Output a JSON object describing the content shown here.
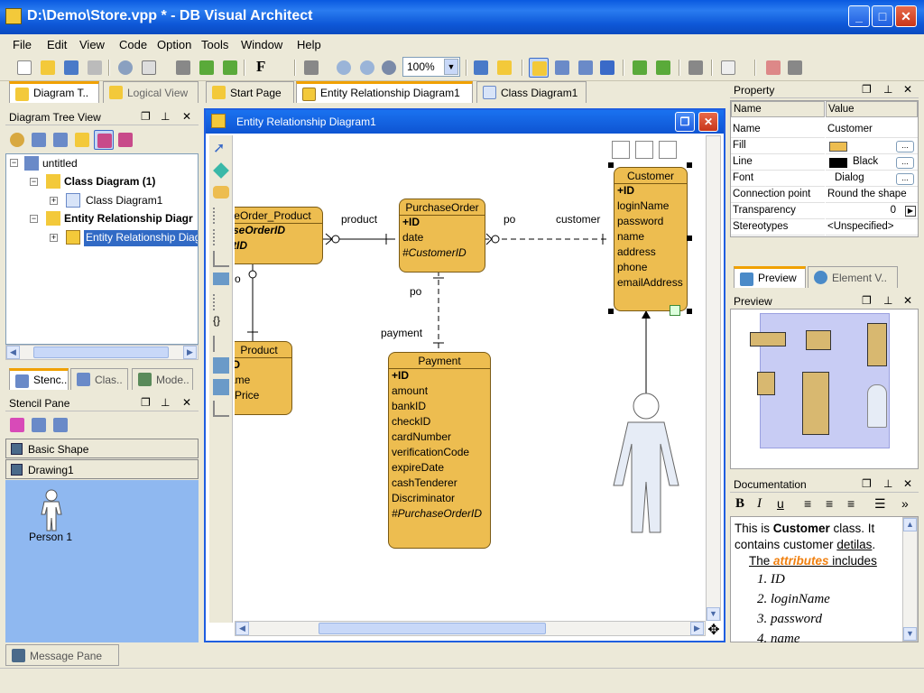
{
  "window": {
    "title": "D:\\Demo\\Store.vpp * - DB Visual Architect"
  },
  "menu": [
    "File",
    "Edit",
    "View",
    "Code",
    "Option",
    "Tools",
    "Window",
    "Help"
  ],
  "toolbar": {
    "zoom": "100%"
  },
  "left_tabs": {
    "diagram_tree": "Diagram T..",
    "logical_view": "Logical View"
  },
  "tree_panel": {
    "title": "Diagram Tree View",
    "nodes": {
      "root": "untitled",
      "class_diagram": "Class Diagram (1)",
      "class_diagram1": "Class Diagram1",
      "erd": "Entity Relationship Diagr",
      "erd1": "Entity Relationship Diag"
    }
  },
  "lower_tabs": {
    "stencil": "Stenc..",
    "class": "Clas..",
    "model": "Mode.."
  },
  "stencil": {
    "title": "Stencil Pane",
    "categories": [
      "Basic Shape",
      "Drawing1"
    ],
    "item": "Person 1"
  },
  "doc_tabs": {
    "start": "Start Page",
    "erd": "Entity Relationship Diagram1",
    "class": "Class Diagram1"
  },
  "diagram": {
    "title": "Entity Relationship Diagram1",
    "entities": {
      "pop": {
        "name": "seOrder_Product",
        "rows": [
          "haseOrderID",
          "uctID"
        ]
      },
      "product": {
        "name": "Product",
        "rows": [
          "ID",
          "ame",
          "itPrice"
        ]
      },
      "purchase_order": {
        "name": "PurchaseOrder",
        "rows": [
          "+ID",
          "date",
          "#CustomerID"
        ]
      },
      "payment": {
        "name": "Payment",
        "rows": [
          "+ID",
          "amount",
          "bankID",
          "checkID",
          "cardNumber",
          "verificationCode",
          "expireDate",
          "cashTenderer",
          "Discriminator",
          "#PurchaseOrderID"
        ]
      },
      "customer": {
        "name": "Customer",
        "rows": [
          "+ID",
          "loginName",
          "password",
          "name",
          "address",
          "phone",
          "emailAddress"
        ]
      }
    },
    "labels": {
      "product": "product",
      "po1": "po",
      "customer": "customer",
      "po2": "po",
      "payment": "payment",
      "po_frag": "o"
    }
  },
  "property": {
    "title": "Property",
    "headers": [
      "Name",
      "Value"
    ],
    "rows": [
      {
        "name": "Name",
        "value": "Customer"
      },
      {
        "name": "Fill",
        "value": ""
      },
      {
        "name": "Line",
        "value": "Black"
      },
      {
        "name": "Font",
        "value": "Dialog"
      },
      {
        "name": "Connection point",
        "value": "Round the shape"
      },
      {
        "name": "Transparency",
        "value": "0"
      },
      {
        "name": "Stereotypes",
        "value": "<Unspecified>"
      }
    ],
    "fill_color": "#edbd50"
  },
  "preview_tabs": {
    "preview": "Preview",
    "element": "Element V.."
  },
  "preview": {
    "title": "Preview"
  },
  "documentation": {
    "title": "Documentation",
    "line1_a": "This is ",
    "line1_b": "Customer",
    "line1_c": " class. It contains customer ",
    "line1_d": "detilas",
    "line1_e": ".",
    "line2_a": "The ",
    "line2_b": "attributes",
    "line2_c": " includes",
    "list": [
      "ID",
      "loginName",
      "password",
      "name"
    ]
  },
  "status": {
    "message_pane": "Message Pane"
  },
  "colors": {
    "accent": "#1f5ee0",
    "entity_fill": "#edbd50",
    "stencil_bg": "#8fb8f0"
  }
}
